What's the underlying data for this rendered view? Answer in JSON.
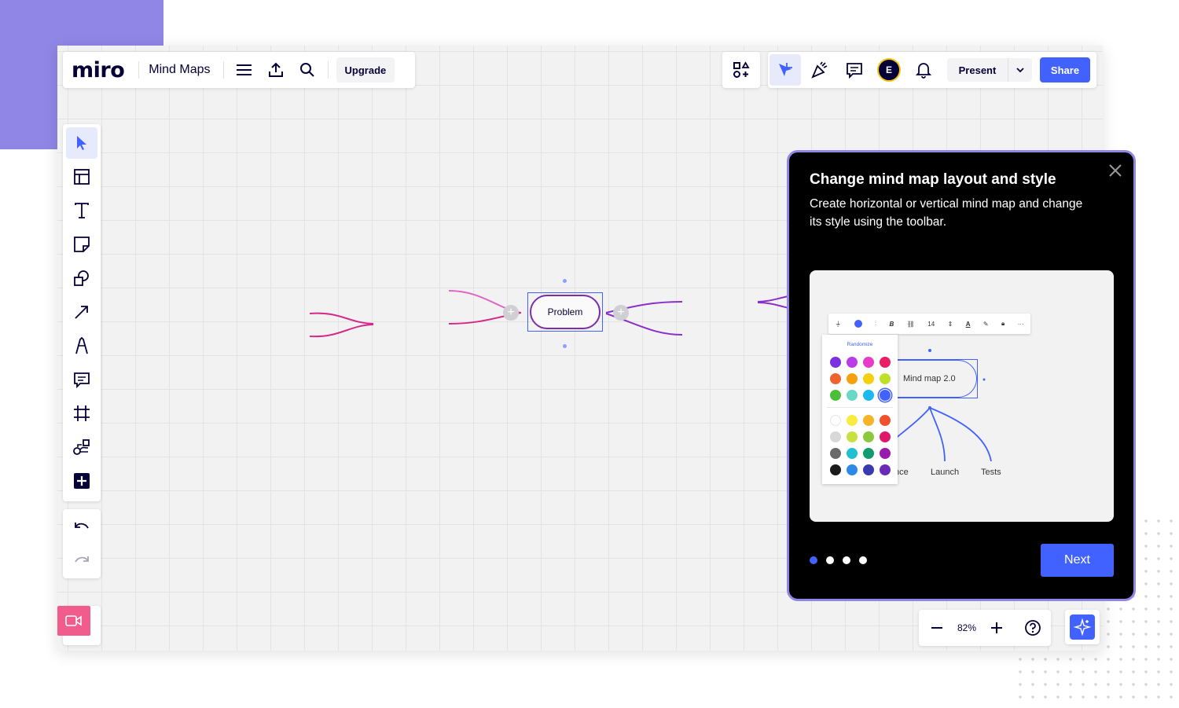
{
  "app": {
    "logo": "miro",
    "board_name": "Mind Maps",
    "upgrade_label": "Upgrade"
  },
  "toolbar": {
    "present_label": "Present",
    "share_label": "Share",
    "avatar_initial": "E"
  },
  "canvas": {
    "node_label": "Problem"
  },
  "zoom": {
    "value": "82%"
  },
  "onboarding": {
    "title": "Change mind map layout and style",
    "description": "Create horizontal or vertical mind map and change its style using the toolbar.",
    "next_label": "Next",
    "steps_total": 4,
    "current_step": 1,
    "preview": {
      "font_size": "14",
      "palette_title": "Randomize",
      "node_label": "Mind map 2.0",
      "children": [
        "nce",
        "Launch",
        "Tests"
      ]
    }
  },
  "colors": {
    "accent": "#4262ff",
    "brand_purple": "#8f86e6",
    "video": "#f25c8c",
    "curve_pink": "#d62a8a",
    "curve_purple": "#8a2fc9"
  }
}
